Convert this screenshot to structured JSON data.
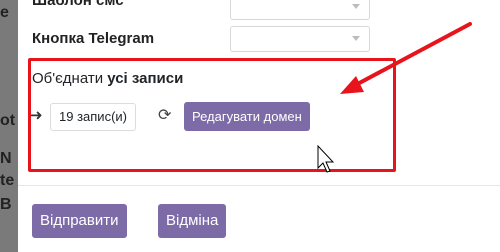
{
  "backdrop": {
    "fragments": [
      "е",
      "ot",
      "N",
      "te",
      "B"
    ]
  },
  "form": {
    "fields": [
      {
        "label": "Шаблон смс"
      },
      {
        "label": "Кнопка Telegram"
      }
    ],
    "merge_text_prefix": "Об'єднати",
    "merge_text_strong": "усі записи",
    "record_count": "19 запис(и)",
    "edit_domain_label": "Редагувати домен"
  },
  "footer": {
    "send_label": "Відправити",
    "cancel_label": "Відміна"
  },
  "colors": {
    "accent": "#7d6ba8",
    "annotation": "#e8141c"
  },
  "icons": {
    "arrow": "arrow-right-icon",
    "refresh": "refresh-icon",
    "cursor": "mouse-cursor-icon",
    "annotation_arrow": "annotation-arrow-icon"
  }
}
